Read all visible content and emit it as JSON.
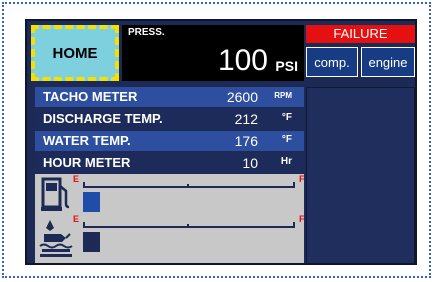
{
  "home": {
    "label": "HOME"
  },
  "pressure": {
    "label": "PRESS.",
    "value": "100",
    "unit": "PSI"
  },
  "failure": {
    "title": "FAILURE",
    "buttons": [
      "comp.",
      "engine"
    ]
  },
  "readings": [
    {
      "label": "TACHO METER",
      "value": "2600",
      "unit": "RPM"
    },
    {
      "label": "DISCHARGE TEMP.",
      "value": "212",
      "unit": "°F"
    },
    {
      "label": "WATER TEMP.",
      "value": "176",
      "unit": "°F"
    },
    {
      "label": "HOUR METER",
      "value": "10",
      "unit": "Hr"
    }
  ],
  "gauges": {
    "fuel": {
      "icon": "fuel-pump-icon",
      "empty_label": "E",
      "full_label": "F",
      "level_fraction": 0.08
    },
    "oil": {
      "icon": "oil-level-icon",
      "empty_label": "E",
      "full_label": "F",
      "level_fraction": 0.08
    }
  },
  "colors": {
    "screen_bg": "#1c2a55",
    "row_highlight": "#2e4fa0",
    "failure_red": "#e51010",
    "home_cyan": "#7fd0df",
    "selection_yellow": "#f5e000"
  }
}
